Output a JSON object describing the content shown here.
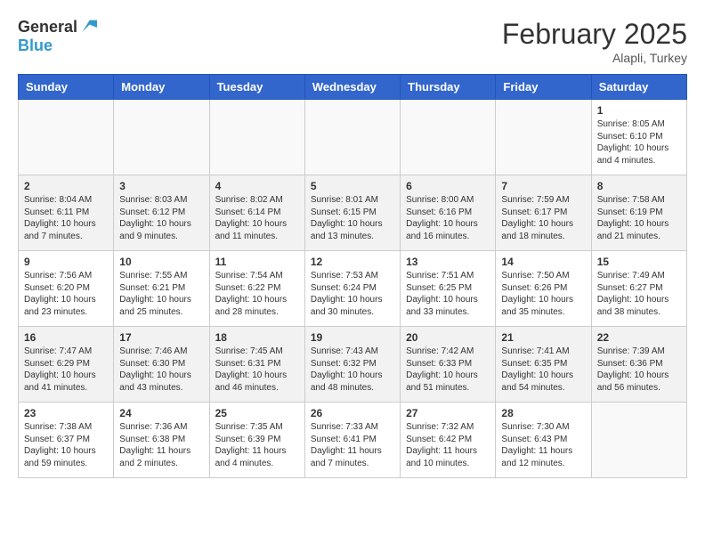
{
  "logo": {
    "general": "General",
    "blue": "Blue"
  },
  "title": "February 2025",
  "subtitle": "Alapli, Turkey",
  "weekdays": [
    "Sunday",
    "Monday",
    "Tuesday",
    "Wednesday",
    "Thursday",
    "Friday",
    "Saturday"
  ],
  "weeks": [
    {
      "shaded": false,
      "days": [
        {
          "num": "",
          "info": ""
        },
        {
          "num": "",
          "info": ""
        },
        {
          "num": "",
          "info": ""
        },
        {
          "num": "",
          "info": ""
        },
        {
          "num": "",
          "info": ""
        },
        {
          "num": "",
          "info": ""
        },
        {
          "num": "1",
          "info": "Sunrise: 8:05 AM\nSunset: 6:10 PM\nDaylight: 10 hours\nand 4 minutes."
        }
      ]
    },
    {
      "shaded": true,
      "days": [
        {
          "num": "2",
          "info": "Sunrise: 8:04 AM\nSunset: 6:11 PM\nDaylight: 10 hours\nand 7 minutes."
        },
        {
          "num": "3",
          "info": "Sunrise: 8:03 AM\nSunset: 6:12 PM\nDaylight: 10 hours\nand 9 minutes."
        },
        {
          "num": "4",
          "info": "Sunrise: 8:02 AM\nSunset: 6:14 PM\nDaylight: 10 hours\nand 11 minutes."
        },
        {
          "num": "5",
          "info": "Sunrise: 8:01 AM\nSunset: 6:15 PM\nDaylight: 10 hours\nand 13 minutes."
        },
        {
          "num": "6",
          "info": "Sunrise: 8:00 AM\nSunset: 6:16 PM\nDaylight: 10 hours\nand 16 minutes."
        },
        {
          "num": "7",
          "info": "Sunrise: 7:59 AM\nSunset: 6:17 PM\nDaylight: 10 hours\nand 18 minutes."
        },
        {
          "num": "8",
          "info": "Sunrise: 7:58 AM\nSunset: 6:19 PM\nDaylight: 10 hours\nand 21 minutes."
        }
      ]
    },
    {
      "shaded": false,
      "days": [
        {
          "num": "9",
          "info": "Sunrise: 7:56 AM\nSunset: 6:20 PM\nDaylight: 10 hours\nand 23 minutes."
        },
        {
          "num": "10",
          "info": "Sunrise: 7:55 AM\nSunset: 6:21 PM\nDaylight: 10 hours\nand 25 minutes."
        },
        {
          "num": "11",
          "info": "Sunrise: 7:54 AM\nSunset: 6:22 PM\nDaylight: 10 hours\nand 28 minutes."
        },
        {
          "num": "12",
          "info": "Sunrise: 7:53 AM\nSunset: 6:24 PM\nDaylight: 10 hours\nand 30 minutes."
        },
        {
          "num": "13",
          "info": "Sunrise: 7:51 AM\nSunset: 6:25 PM\nDaylight: 10 hours\nand 33 minutes."
        },
        {
          "num": "14",
          "info": "Sunrise: 7:50 AM\nSunset: 6:26 PM\nDaylight: 10 hours\nand 35 minutes."
        },
        {
          "num": "15",
          "info": "Sunrise: 7:49 AM\nSunset: 6:27 PM\nDaylight: 10 hours\nand 38 minutes."
        }
      ]
    },
    {
      "shaded": true,
      "days": [
        {
          "num": "16",
          "info": "Sunrise: 7:47 AM\nSunset: 6:29 PM\nDaylight: 10 hours\nand 41 minutes."
        },
        {
          "num": "17",
          "info": "Sunrise: 7:46 AM\nSunset: 6:30 PM\nDaylight: 10 hours\nand 43 minutes."
        },
        {
          "num": "18",
          "info": "Sunrise: 7:45 AM\nSunset: 6:31 PM\nDaylight: 10 hours\nand 46 minutes."
        },
        {
          "num": "19",
          "info": "Sunrise: 7:43 AM\nSunset: 6:32 PM\nDaylight: 10 hours\nand 48 minutes."
        },
        {
          "num": "20",
          "info": "Sunrise: 7:42 AM\nSunset: 6:33 PM\nDaylight: 10 hours\nand 51 minutes."
        },
        {
          "num": "21",
          "info": "Sunrise: 7:41 AM\nSunset: 6:35 PM\nDaylight: 10 hours\nand 54 minutes."
        },
        {
          "num": "22",
          "info": "Sunrise: 7:39 AM\nSunset: 6:36 PM\nDaylight: 10 hours\nand 56 minutes."
        }
      ]
    },
    {
      "shaded": false,
      "days": [
        {
          "num": "23",
          "info": "Sunrise: 7:38 AM\nSunset: 6:37 PM\nDaylight: 10 hours\nand 59 minutes."
        },
        {
          "num": "24",
          "info": "Sunrise: 7:36 AM\nSunset: 6:38 PM\nDaylight: 11 hours\nand 2 minutes."
        },
        {
          "num": "25",
          "info": "Sunrise: 7:35 AM\nSunset: 6:39 PM\nDaylight: 11 hours\nand 4 minutes."
        },
        {
          "num": "26",
          "info": "Sunrise: 7:33 AM\nSunset: 6:41 PM\nDaylight: 11 hours\nand 7 minutes."
        },
        {
          "num": "27",
          "info": "Sunrise: 7:32 AM\nSunset: 6:42 PM\nDaylight: 11 hours\nand 10 minutes."
        },
        {
          "num": "28",
          "info": "Sunrise: 7:30 AM\nSunset: 6:43 PM\nDaylight: 11 hours\nand 12 minutes."
        },
        {
          "num": "",
          "info": ""
        }
      ]
    }
  ]
}
